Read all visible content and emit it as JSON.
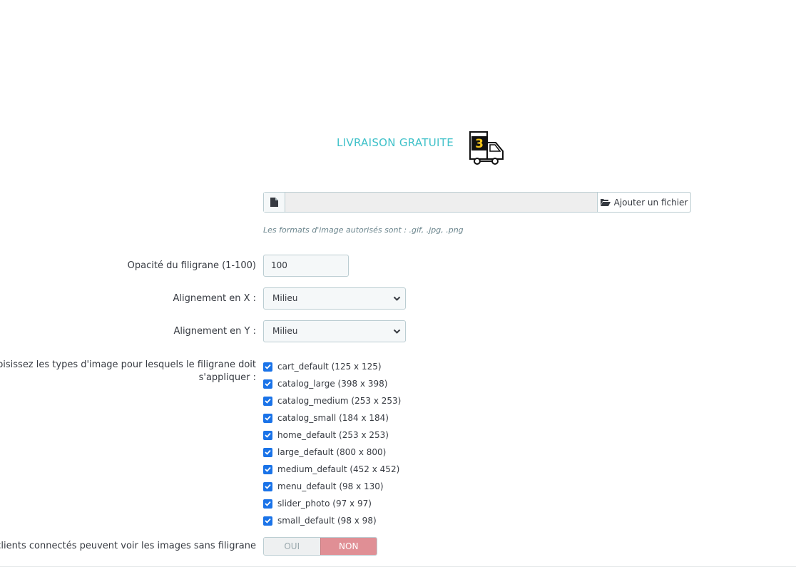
{
  "logo": {
    "text": "LIVRAISON GRATUITE",
    "badge_letter": "3"
  },
  "file_upload": {
    "button_label": "Ajouter un fichier",
    "help": "Les formats d'image autorisés sont : .gif, .jpg, .png"
  },
  "opacity": {
    "label": "Opacité du filigrane (1-100)",
    "value": "100"
  },
  "align_x": {
    "label": "Alignement en X :",
    "value": "Milieu"
  },
  "align_y": {
    "label": "Alignement en Y :",
    "value": "Milieu"
  },
  "image_types": {
    "label_line1": "Choisissez les types d'image pour lesquels le filigrane doit",
    "label_line2": "s'appliquer :",
    "items": [
      {
        "label": "cart_default (125 x 125)",
        "checked": true
      },
      {
        "label": "catalog_large (398 x 398)",
        "checked": true
      },
      {
        "label": "catalog_medium (253 x 253)",
        "checked": true
      },
      {
        "label": "catalog_small (184 x 184)",
        "checked": true
      },
      {
        "label": "home_default (253 x 253)",
        "checked": true
      },
      {
        "label": "large_default (800 x 800)",
        "checked": true
      },
      {
        "label": "medium_default (452 x 452)",
        "checked": true
      },
      {
        "label": "menu_default (98 x 130)",
        "checked": true
      },
      {
        "label": "slider_photo (97 x 97)",
        "checked": true
      },
      {
        "label": "small_default (98 x 98)",
        "checked": true
      }
    ]
  },
  "logged_clients": {
    "label": "Les clients connectés peuvent voir les images sans filigrane",
    "yes_label": "OUI",
    "no_label": "NON",
    "selected": "NON"
  },
  "colors": {
    "logo_teal": "#3fc1c9",
    "badge_yellow": "#f5c518",
    "checkbox_blue": "#1a73e8",
    "switch_non": "#e08f95"
  }
}
